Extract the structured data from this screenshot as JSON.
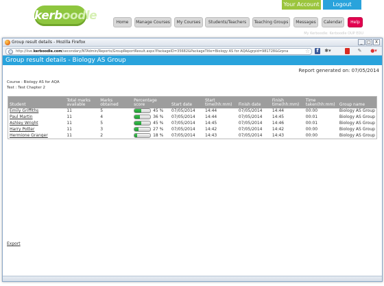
{
  "site": {
    "logo": {
      "part1": "kerb",
      "part2": "oodle"
    },
    "account_links": [
      "Your Account",
      "Logout"
    ],
    "nav": [
      "Home",
      "Manage Courses",
      "My Courses",
      "Students/Teachers",
      "Teaching Groups",
      "Messages",
      "Calendar",
      "Help"
    ],
    "subtext": "My Kerboodle: Kerboodle OUP EDU",
    "colors": {
      "brand_green": "#8ec63f",
      "accent_blue": "#29a3dc",
      "help_pink": "#e2004f"
    }
  },
  "browser": {
    "title": "Group result details - Mozilla Firefox",
    "url_prefix": "http://live.",
    "url_domain": "kerboodle.com",
    "url_rest": "/secondary/NTAdmin/Reports/GroupReportResult.aspx?PackageID=35682&PackageTitle=Biology AS for AQA&grpid=981728&Grpna",
    "window_controls": [
      "_",
      "□",
      "X"
    ],
    "icons": [
      "globe-icon",
      "star-icon",
      "facebook-icon",
      "bookmark-icon",
      "pdf-icon",
      "edit-icon",
      "addon-icon"
    ]
  },
  "page": {
    "header": "Group result details - Biology AS Group",
    "report_generated": "Report generated on: 07/05/2014",
    "course": "Course : Biology AS for AQA",
    "test": "Test : Test Chapter 2",
    "export": "Export",
    "table": {
      "columns": [
        "Student",
        "Total marks available",
        "Marks obtained",
        "Percentage score",
        "Start date",
        "Start time(hh:mm)",
        "Finish date",
        "Finish time(hh:mm)",
        "Time taken(hh:mm)",
        "Group name"
      ],
      "rows": [
        {
          "student": "Emily Griffiths",
          "total": "11",
          "obtained": "5",
          "percent": "45 %",
          "pct_value": 45,
          "start_date": "07/05/2014",
          "start_time": "14:44",
          "finish_date": "07/05/2014",
          "finish_time": "14:44",
          "time_taken": "00:00",
          "group": "Biology AS Group"
        },
        {
          "student": "Paul Martin",
          "total": "11",
          "obtained": "4",
          "percent": "36 %",
          "pct_value": 36,
          "start_date": "07/05/2014",
          "start_time": "14:44",
          "finish_date": "07/05/2014",
          "finish_time": "14:45",
          "time_taken": "00:01",
          "group": "Biology AS Group"
        },
        {
          "student": "Ashley Wright",
          "total": "11",
          "obtained": "5",
          "percent": "45 %",
          "pct_value": 45,
          "start_date": "07/05/2014",
          "start_time": "14:45",
          "finish_date": "07/05/2014",
          "finish_time": "14:46",
          "time_taken": "00:01",
          "group": "Biology AS Group"
        },
        {
          "student": "Harry Potter",
          "total": "11",
          "obtained": "3",
          "percent": "27 %",
          "pct_value": 27,
          "start_date": "07/05/2014",
          "start_time": "14:42",
          "finish_date": "07/05/2014",
          "finish_time": "14:42",
          "time_taken": "00:00",
          "group": "Biology AS Group"
        },
        {
          "student": "Hermione Granger",
          "total": "11",
          "obtained": "2",
          "percent": "18 %",
          "pct_value": 18,
          "start_date": "07/05/2014",
          "start_time": "14:43",
          "finish_date": "07/05/2014",
          "finish_time": "14:43",
          "time_taken": "00:00",
          "group": "Biology AS Group"
        }
      ]
    }
  }
}
